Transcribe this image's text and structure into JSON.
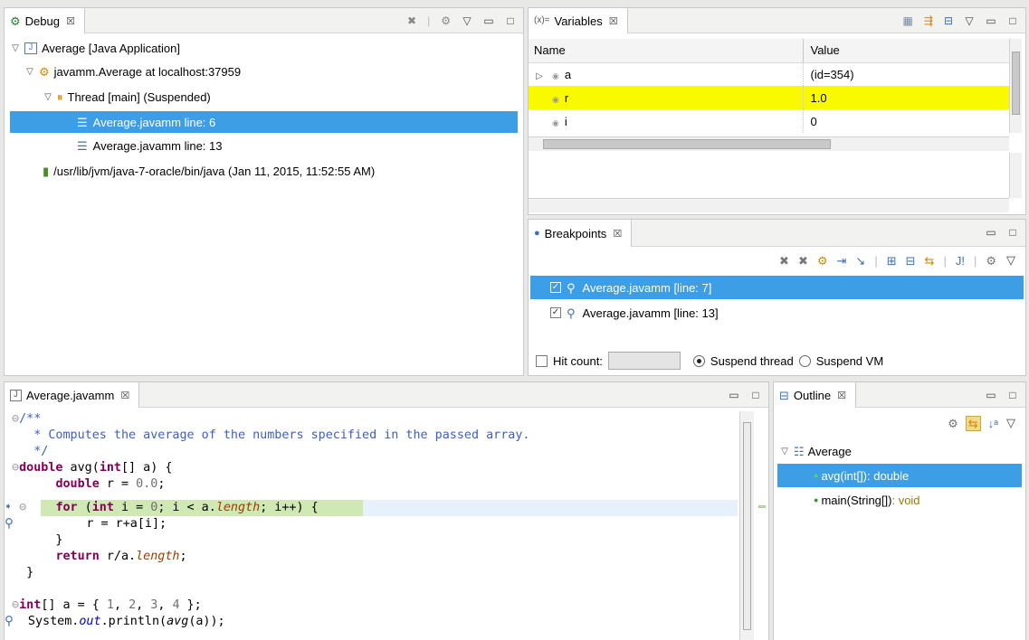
{
  "debug": {
    "tab_label": "Debug",
    "close": "☒",
    "tree": [
      {
        "label": "Average [Java Application]"
      },
      {
        "label": "javamm.Average at localhost:37959"
      },
      {
        "label": "Thread [main] (Suspended)"
      },
      {
        "label": "Average.javamm line: 6"
      },
      {
        "label": "Average.javamm line: 13"
      },
      {
        "label": "/usr/lib/jvm/java-7-oracle/bin/java (Jan 11, 2015, 11:52:55 AM)"
      }
    ]
  },
  "variables": {
    "tab_label": "Variables",
    "tab_prefix": "(x)=",
    "close": "☒",
    "columns": [
      "Name",
      "Value"
    ],
    "rows": [
      {
        "name": "a",
        "value": "(id=354)"
      },
      {
        "name": "r",
        "value": "1.0"
      },
      {
        "name": "i",
        "value": "0"
      }
    ]
  },
  "breakpoints": {
    "tab_label": "Breakpoints",
    "close": "☒",
    "items": [
      {
        "label": "Average.javamm [line: 7]",
        "checked": true
      },
      {
        "label": "Average.javamm [line: 13]",
        "checked": true
      }
    ],
    "hit_count_label": "Hit count:",
    "hit_count_value": "",
    "suspend_thread_label": "Suspend thread",
    "suspend_vm_label": "Suspend VM"
  },
  "editor": {
    "tab_label": "Average.javamm",
    "close": "☒"
  },
  "outline": {
    "tab_label": "Outline",
    "close": "☒",
    "root": "Average",
    "items": [
      {
        "name": "avg(int[])",
        "type": " : double"
      },
      {
        "name": "main(String[])",
        "type": " : void"
      }
    ]
  },
  "colors": {
    "selection": "#3d9ee6",
    "highlight_value": "#f9f900",
    "current_line": "#cfe8b4",
    "keyword": "#7f0055",
    "comment": "#3f5fbf"
  }
}
